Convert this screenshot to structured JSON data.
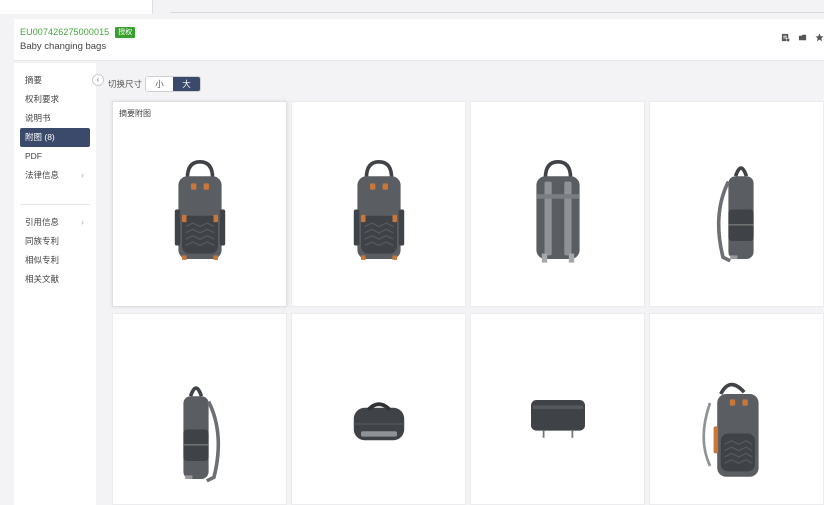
{
  "header": {
    "patent_number": "EU007426275000015",
    "status_badge": "授权",
    "title": "Baby changing bags"
  },
  "sidebar": {
    "items": [
      {
        "label": "摘要",
        "active": false,
        "chevron": false
      },
      {
        "label": "权利要求",
        "active": false,
        "chevron": false
      },
      {
        "label": "说明书",
        "active": false,
        "chevron": false
      },
      {
        "label": "附图 (8)",
        "active": true,
        "chevron": false
      },
      {
        "label": "PDF",
        "active": false,
        "chevron": false
      },
      {
        "label": "法律信息",
        "active": false,
        "chevron": true
      }
    ],
    "items2": [
      {
        "label": "引用信息",
        "chevron": true
      },
      {
        "label": "同族专利",
        "chevron": false
      },
      {
        "label": "相似专利",
        "chevron": false
      },
      {
        "label": "相关文献",
        "chevron": false
      }
    ],
    "collapse_icon": "chevron-left-icon"
  },
  "main": {
    "size_label": "切换尺寸",
    "size_small": "小",
    "size_large": "大",
    "selected_size": "大",
    "first_caption": "摘要附图",
    "figures": [
      {
        "view": "front"
      },
      {
        "view": "front"
      },
      {
        "view": "back"
      },
      {
        "view": "side-right"
      },
      {
        "view": "side-left"
      },
      {
        "view": "top"
      },
      {
        "view": "bottom"
      },
      {
        "view": "perspective"
      }
    ]
  },
  "colors": {
    "accent_green": "#3aa12e",
    "nav_active": "#3b4a6b",
    "bag_body": "#5a5d61",
    "bag_dark": "#3f4246",
    "leather": "#c8773a"
  }
}
